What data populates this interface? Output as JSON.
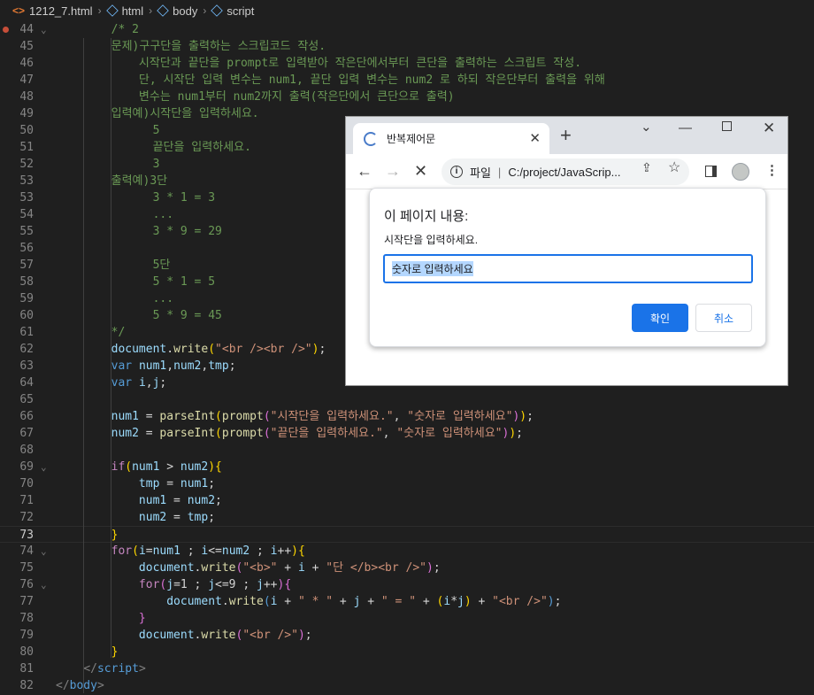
{
  "breadcrumb": {
    "file": "1212_7.html",
    "html": "html",
    "body": "body",
    "script": "script"
  },
  "editor": {
    "lines": [
      {
        "n": "44",
        "tokens": [
          [
            "        ",
            ""
          ],
          [
            "/* 2",
            "c"
          ]
        ]
      },
      {
        "n": "45",
        "tokens": [
          [
            "        ",
            ""
          ],
          [
            "문제)구구단을 출력하는 스크립코드 작성.",
            "c"
          ]
        ]
      },
      {
        "n": "46",
        "tokens": [
          [
            "            ",
            ""
          ],
          [
            "시작단과 끝단을 prompt로 입력받아 작은단에서부터 큰단을 출력하는 스크립트 작성.",
            "c"
          ]
        ]
      },
      {
        "n": "47",
        "tokens": [
          [
            "            ",
            ""
          ],
          [
            "단, 시작단 입력 변수는 num1, 끝단 입력 변수는 num2 로 하되 작은단부터 출력을 위해",
            "c"
          ]
        ]
      },
      {
        "n": "48",
        "tokens": [
          [
            "            ",
            ""
          ],
          [
            "변수는 num1부터 num2까지 출력(작은단에서 큰단으로 출력)",
            "c"
          ]
        ]
      },
      {
        "n": "49",
        "tokens": [
          [
            "        ",
            ""
          ],
          [
            "입력예)시작단을 입력하세요.",
            "c"
          ]
        ]
      },
      {
        "n": "50",
        "tokens": [
          [
            "              ",
            ""
          ],
          [
            "5",
            "c"
          ]
        ]
      },
      {
        "n": "51",
        "tokens": [
          [
            "              ",
            ""
          ],
          [
            "끝단을 입력하세요.",
            "c"
          ]
        ]
      },
      {
        "n": "52",
        "tokens": [
          [
            "              ",
            ""
          ],
          [
            "3",
            "c"
          ]
        ]
      },
      {
        "n": "53",
        "tokens": [
          [
            "        ",
            ""
          ],
          [
            "출력예)3단",
            "c"
          ]
        ]
      },
      {
        "n": "53",
        "tokens": [
          [
            "              ",
            ""
          ],
          [
            "3 * 1 = 3",
            "c"
          ]
        ]
      },
      {
        "n": "54",
        "tokens": [
          [
            "              ",
            ""
          ],
          [
            "...",
            "c"
          ]
        ]
      },
      {
        "n": "55",
        "tokens": [
          [
            "              ",
            ""
          ],
          [
            "3 * 9 = 29",
            "c"
          ]
        ]
      },
      {
        "n": "56",
        "tokens": []
      },
      {
        "n": "57",
        "tokens": [
          [
            "              ",
            ""
          ],
          [
            "5단",
            "c"
          ]
        ]
      },
      {
        "n": "58",
        "tokens": [
          [
            "              ",
            ""
          ],
          [
            "5 * 1 = 5",
            "c"
          ]
        ]
      },
      {
        "n": "59",
        "tokens": [
          [
            "              ",
            ""
          ],
          [
            "...",
            "c"
          ]
        ]
      },
      {
        "n": "60",
        "tokens": [
          [
            "              ",
            ""
          ],
          [
            "5 * 9 = 45",
            "c"
          ]
        ]
      },
      {
        "n": "61",
        "tokens": [
          [
            "        ",
            ""
          ],
          [
            "*/",
            "c"
          ]
        ]
      },
      {
        "n": "62",
        "tokens": [
          [
            "        ",
            ""
          ],
          [
            "document",
            "v"
          ],
          [
            ".",
            ""
          ],
          [
            "write",
            "f"
          ],
          [
            "(",
            "b"
          ],
          [
            "\"<br /><br />\"",
            "s"
          ],
          [
            ")",
            "b"
          ],
          [
            ";",
            ""
          ]
        ]
      },
      {
        "n": "63",
        "tokens": [
          [
            "        ",
            ""
          ],
          [
            "var",
            "k"
          ],
          [
            " ",
            ""
          ],
          [
            "num1",
            "v"
          ],
          [
            ",",
            ""
          ],
          [
            "num2",
            "v"
          ],
          [
            ",",
            ""
          ],
          [
            "tmp",
            "v"
          ],
          [
            ";",
            ""
          ]
        ]
      },
      {
        "n": "64",
        "tokens": [
          [
            "        ",
            ""
          ],
          [
            "var",
            "k"
          ],
          [
            " ",
            ""
          ],
          [
            "i",
            "v"
          ],
          [
            ",",
            ""
          ],
          [
            "j",
            "v"
          ],
          [
            ";",
            ""
          ]
        ]
      },
      {
        "n": "65",
        "tokens": []
      },
      {
        "n": "66",
        "tokens": [
          [
            "        ",
            ""
          ],
          [
            "num1",
            "v"
          ],
          [
            " = ",
            ""
          ],
          [
            "parseInt",
            "f"
          ],
          [
            "(",
            "b"
          ],
          [
            "prompt",
            "f"
          ],
          [
            "(",
            "b2"
          ],
          [
            "\"시작단을 입력하세요.\"",
            "s"
          ],
          [
            ", ",
            ""
          ],
          [
            "\"숫자로 입력하세요\"",
            "s"
          ],
          [
            ")",
            "b2"
          ],
          [
            ")",
            "b"
          ],
          [
            ";",
            ""
          ]
        ]
      },
      {
        "n": "67",
        "tokens": [
          [
            "        ",
            ""
          ],
          [
            "num2",
            "v"
          ],
          [
            " = ",
            ""
          ],
          [
            "parseInt",
            "f"
          ],
          [
            "(",
            "b"
          ],
          [
            "prompt",
            "f"
          ],
          [
            "(",
            "b2"
          ],
          [
            "\"끝단을 입력하세요.\"",
            "s"
          ],
          [
            ", ",
            ""
          ],
          [
            "\"숫자로 입력하세요\"",
            "s"
          ],
          [
            ")",
            "b2"
          ],
          [
            ")",
            "b"
          ],
          [
            ";",
            ""
          ]
        ]
      },
      {
        "n": "68",
        "tokens": []
      },
      {
        "n": "69",
        "tokens": [
          [
            "        ",
            ""
          ],
          [
            "if",
            "kw"
          ],
          [
            "(",
            "b"
          ],
          [
            "num1",
            "v"
          ],
          [
            " > ",
            ""
          ],
          [
            "num2",
            "v"
          ],
          [
            ")",
            "b"
          ],
          [
            "{",
            "b"
          ]
        ]
      },
      {
        "n": "70",
        "tokens": [
          [
            "            ",
            ""
          ],
          [
            "tmp",
            "v"
          ],
          [
            " = ",
            ""
          ],
          [
            "num1",
            "v"
          ],
          [
            ";",
            ""
          ]
        ]
      },
      {
        "n": "71",
        "tokens": [
          [
            "            ",
            ""
          ],
          [
            "num1",
            "v"
          ],
          [
            " = ",
            ""
          ],
          [
            "num2",
            "v"
          ],
          [
            ";",
            ""
          ]
        ]
      },
      {
        "n": "72",
        "tokens": [
          [
            "            ",
            ""
          ],
          [
            "num2",
            "v"
          ],
          [
            " = ",
            ""
          ],
          [
            "tmp",
            "v"
          ],
          [
            ";",
            ""
          ]
        ]
      },
      {
        "n": "73",
        "tokens": [
          [
            "        ",
            ""
          ],
          [
            "}",
            "b"
          ]
        ]
      },
      {
        "n": "74",
        "tokens": [
          [
            "        ",
            ""
          ],
          [
            "for",
            "kw"
          ],
          [
            "(",
            "b"
          ],
          [
            "i",
            "v"
          ],
          [
            "=",
            ""
          ],
          [
            "num1",
            "v"
          ],
          [
            " ; ",
            ""
          ],
          [
            "i",
            "v"
          ],
          [
            "<=",
            ""
          ],
          [
            "num2",
            "v"
          ],
          [
            " ; ",
            ""
          ],
          [
            "i",
            "v"
          ],
          [
            "++",
            ""
          ],
          [
            ")",
            "b"
          ],
          [
            "{",
            "b"
          ]
        ]
      },
      {
        "n": "75",
        "tokens": [
          [
            "            ",
            ""
          ],
          [
            "document",
            "v"
          ],
          [
            ".",
            ""
          ],
          [
            "write",
            "f"
          ],
          [
            "(",
            "b2"
          ],
          [
            "\"<b>\"",
            "s"
          ],
          [
            " + ",
            ""
          ],
          [
            "i",
            "v"
          ],
          [
            " + ",
            ""
          ],
          [
            "\"단 </b><br />\"",
            "s"
          ],
          [
            ")",
            "b2"
          ],
          [
            ";",
            ""
          ]
        ]
      },
      {
        "n": "76",
        "tokens": [
          [
            "            ",
            ""
          ],
          [
            "for",
            "kw"
          ],
          [
            "(",
            "b2"
          ],
          [
            "j",
            "v"
          ],
          [
            "=1 ; ",
            ""
          ],
          [
            "j",
            "v"
          ],
          [
            "<=9 ; ",
            ""
          ],
          [
            "j",
            "v"
          ],
          [
            "++",
            ""
          ],
          [
            ")",
            "b2"
          ],
          [
            "{",
            "b2"
          ]
        ]
      },
      {
        "n": "77",
        "tokens": [
          [
            "                ",
            ""
          ],
          [
            "document",
            "v"
          ],
          [
            ".",
            ""
          ],
          [
            "write",
            "f"
          ],
          [
            "(",
            "k"
          ],
          [
            "i",
            "v"
          ],
          [
            " + ",
            ""
          ],
          [
            "\" * \"",
            "s"
          ],
          [
            " + ",
            ""
          ],
          [
            "j",
            "v"
          ],
          [
            " + ",
            ""
          ],
          [
            "\" = \"",
            "s"
          ],
          [
            " + ",
            ""
          ],
          [
            "(",
            "b"
          ],
          [
            "i",
            "v"
          ],
          [
            "*",
            ""
          ],
          [
            "j",
            "v"
          ],
          [
            ")",
            "b"
          ],
          [
            " + ",
            ""
          ],
          [
            "\"<br />\"",
            "s"
          ],
          [
            ")",
            "k"
          ],
          [
            ";",
            ""
          ]
        ]
      },
      {
        "n": "78",
        "tokens": [
          [
            "            ",
            ""
          ],
          [
            "}",
            "b2"
          ]
        ]
      },
      {
        "n": "79",
        "tokens": [
          [
            "            ",
            ""
          ],
          [
            "document",
            "v"
          ],
          [
            ".",
            ""
          ],
          [
            "write",
            "f"
          ],
          [
            "(",
            "b2"
          ],
          [
            "\"<br />\"",
            "s"
          ],
          [
            ")",
            "b2"
          ],
          [
            ";",
            ""
          ]
        ]
      },
      {
        "n": "80",
        "tokens": [
          [
            "        ",
            ""
          ],
          [
            "}",
            "b"
          ]
        ]
      },
      {
        "n": "81",
        "tokens": [
          [
            "    ",
            ""
          ],
          [
            "</",
            "t"
          ],
          [
            "script",
            "tg"
          ],
          [
            ">",
            "t"
          ]
        ]
      },
      {
        "n": "82",
        "tokens": [
          [
            "",
            ""
          ],
          [
            "</",
            "t"
          ],
          [
            "body",
            "tg"
          ],
          [
            ">",
            "t"
          ]
        ]
      }
    ]
  },
  "browser": {
    "tab_title": "반복제어문",
    "omnibox_label": "파일",
    "omnibox_url": "C:/project/JavaScrip...",
    "dialog": {
      "title": "이 페이지 내용:",
      "message": "시작단을 입력하세요.",
      "input_value": "숫자로 입력하세요",
      "ok_label": "확인",
      "cancel_label": "취소"
    }
  }
}
